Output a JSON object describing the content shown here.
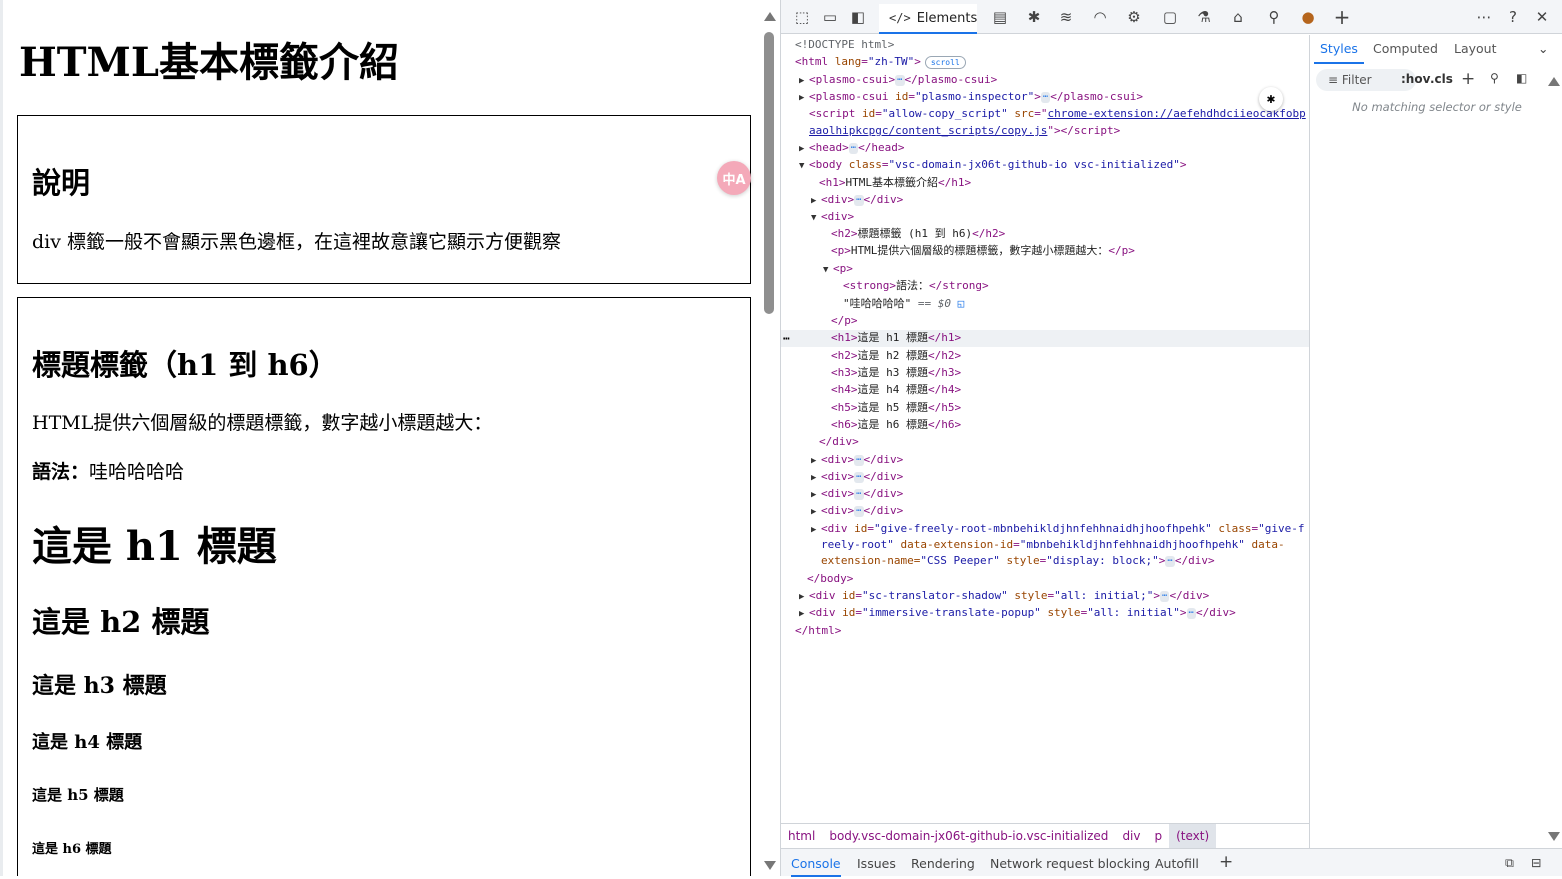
{
  "page": {
    "title": "HTML基本標籤介紹",
    "box1": {
      "heading": "說明",
      "text": "div 標籤一般不會顯示黑色邊框，在這裡故意讓它顯示方便觀察"
    },
    "box2": {
      "heading": "標題標籤（h1 到 h6）",
      "intro": "HTML提供六個層級的標題標籤，數字越小標題越大：",
      "syntax_label": "語法：",
      "syntax_value": "哇哈哈哈哈",
      "h1": "這是 h1 標題",
      "h2": "這是 h2 標題",
      "h3": "這是 h3 標題",
      "h4": "這是 h4 標題",
      "h5": "這是 h5 標題",
      "h6": "這是 h6 標題"
    },
    "translate_badge": "中A"
  },
  "devtools": {
    "elements_tab": "Elements",
    "styles_tabs": [
      "Styles",
      "Computed",
      "Layout"
    ],
    "filter_placeholder": "Filter",
    "hov": ":hov",
    "cls": ".cls",
    "no_match": "No matching selector or style",
    "breadcrumbs": [
      "html",
      "body.vsc-domain-jx06t-github-io.vsc-initialized",
      "div",
      "p",
      "(text)"
    ],
    "drawer_tabs": [
      "Console",
      "Issues",
      "Rendering",
      "Network request blocking",
      "Autofill"
    ],
    "dom": {
      "doctype": "<!DOCTYPE html>",
      "html_open_tag": "html",
      "html_lang_attr": "lang",
      "html_lang_val": "\"zh-TW\"",
      "scroll_badge": "scroll",
      "plasmo1": "plasmo-csui",
      "plasmo2_id": "\"plasmo-inspector\"",
      "script_id": "\"allow-copy_script\"",
      "script_src1": "chrome-extension://aefehdhdciieocakfobp",
      "script_src2": "aaolhipkcpgc/content_scripts/copy.js",
      "head": "head",
      "body_class": "\"vsc-domain-jx06t-github-io vsc-initialized\"",
      "h1_text": "HTML基本標籤介紹",
      "h2_text": "標題標籤 (h1 到 h6)",
      "p_text": "HTML提供六個層級的標題標籤，數字越小標題越大：",
      "strong_text": "語法：",
      "text_node": "\"哇哈哈哈哈\"",
      "eq_dollar": "== $0",
      "h_lines": [
        "這是 h1 標題",
        "這是 h2 標題",
        "這是 h3 標題",
        "這是 h4 標題",
        "這是 h5 標題",
        "這是 h6 標題"
      ],
      "give_id": "\"give-freely-root-mbnbehikldjhnfehhnaidhjhoofhpehk\"",
      "give_class1": "\"give-f",
      "give_class2": "reely-root\"",
      "give_ext_id": "\"mbnbehikldjhnfehhnaidhjhoofhpehk\"",
      "give_data": "data-",
      "give_ext_name_attr": "extension-name=",
      "give_ext_name": "\"CSS Peeper\"",
      "give_style": "\"display: block;\"",
      "sc_id": "\"sc-translator-shadow\"",
      "sc_style": "\"all: initial;\"",
      "imm_id": "\"immersive-translate-popup\"",
      "imm_style": "\"all: initial\""
    }
  }
}
